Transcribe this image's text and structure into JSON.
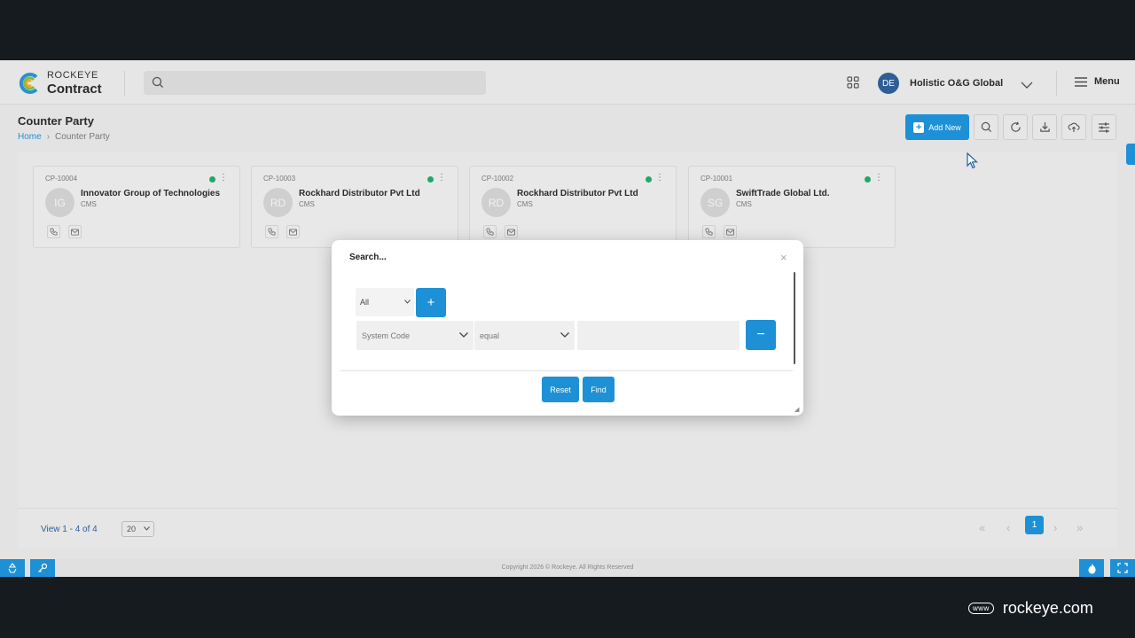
{
  "header": {
    "brand_top": "ROCKEYE",
    "brand_bottom": "Contract",
    "user_initials": "DE",
    "org_name": "Holistic O&G Global",
    "menu_label": "Menu"
  },
  "page": {
    "title": "Counter Party",
    "breadcrumb_home": "Home",
    "breadcrumb_current": "Counter Party",
    "add_new_label": "Add New"
  },
  "cards": [
    {
      "code": "CP-10004",
      "initials": "IG",
      "name": "Innovator Group of Technologies",
      "type": "CMS"
    },
    {
      "code": "CP-10003",
      "initials": "RD",
      "name": "Rockhard Distributor Pvt Ltd",
      "type": "CMS"
    },
    {
      "code": "CP-10002",
      "initials": "RD",
      "name": "Rockhard Distributor Pvt Ltd",
      "type": "CMS"
    },
    {
      "code": "CP-10001",
      "initials": "SG",
      "name": "SwiftTrade Global Ltd.",
      "type": "CMS"
    }
  ],
  "pagination": {
    "view_text": "View 1 - 4 of 4",
    "page_size": "20",
    "current_page": "1"
  },
  "footer": {
    "copyright": "Copyright 2026 © Rockeye. All Rights Reserved"
  },
  "modal": {
    "title": "Search...",
    "close_glyph": "×",
    "logic_value": "All",
    "plus_glyph": "+",
    "field_value": "System Code",
    "operator_value": "equal",
    "minus_glyph": "−",
    "reset_label": "Reset",
    "find_label": "Find"
  },
  "watermark": {
    "www": "www",
    "url": "rockeye.com"
  },
  "colors": {
    "accent": "#1e90d6",
    "status_active": "#22a66b",
    "avatar_user": "#2e5e96"
  }
}
